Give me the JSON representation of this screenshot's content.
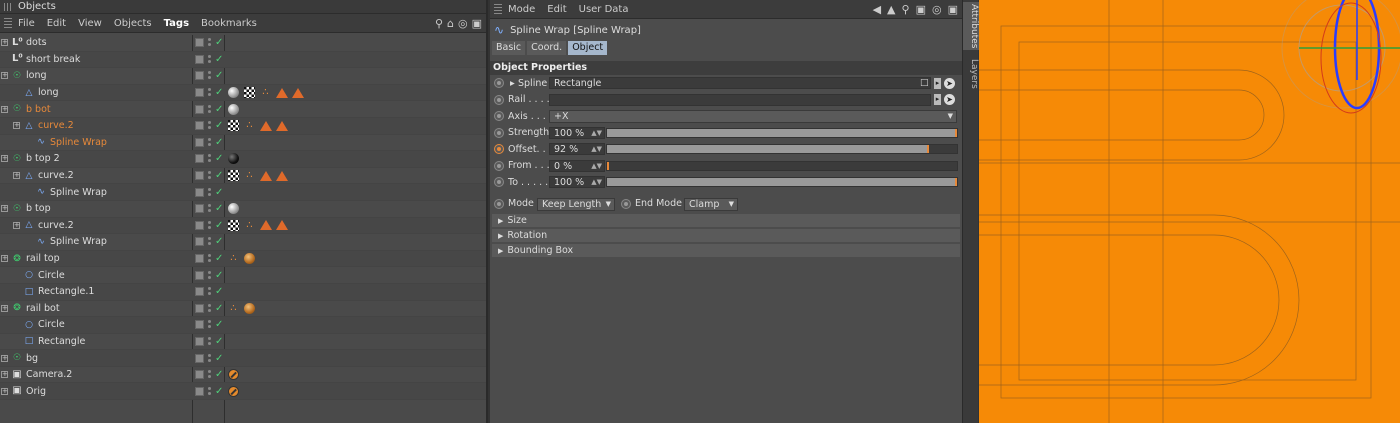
{
  "objects_panel": {
    "title": "Objects",
    "menu": [
      "File",
      "Edit",
      "View",
      "Objects",
      "Tags",
      "Bookmarks"
    ],
    "rows": [
      {
        "name": "dots",
        "icon": "null",
        "level": 0,
        "expand": true,
        "tags": []
      },
      {
        "name": "short break",
        "icon": "null",
        "level": 0,
        "expand": false,
        "tags": []
      },
      {
        "name": "long",
        "icon": "cloner",
        "level": 0,
        "expand": true,
        "tags": []
      },
      {
        "name": "long",
        "icon": "spline-tri",
        "level": 1,
        "expand": false,
        "tags": [
          "sphere",
          "check",
          "orangedots",
          "tri",
          "tri"
        ]
      },
      {
        "name": "b bot",
        "icon": "cloner",
        "level": 0,
        "expand": true,
        "orange": true,
        "tags": [
          "sphere"
        ]
      },
      {
        "name": "curve.2",
        "icon": "spline-tri",
        "level": 1,
        "expand": true,
        "orange": true,
        "tags": [
          "check",
          "orangedots",
          "tri",
          "tri"
        ]
      },
      {
        "name": "Spline Wrap",
        "icon": "splinewrap",
        "level": 2,
        "expand": false,
        "orange": true,
        "tags": []
      },
      {
        "name": "b top 2",
        "icon": "cloner",
        "level": 0,
        "expand": true,
        "tags": [
          "darksphere"
        ]
      },
      {
        "name": "curve.2",
        "icon": "spline-tri",
        "level": 1,
        "expand": true,
        "tags": [
          "check",
          "orangedots",
          "tri",
          "tri"
        ]
      },
      {
        "name": "Spline Wrap",
        "icon": "splinewrap",
        "level": 2,
        "expand": false,
        "tags": []
      },
      {
        "name": "b top",
        "icon": "cloner",
        "level": 0,
        "expand": true,
        "tags": [
          "sphere"
        ]
      },
      {
        "name": "curve.2",
        "icon": "spline-tri",
        "level": 1,
        "expand": true,
        "tags": [
          "check",
          "orangedots",
          "tri",
          "tri"
        ]
      },
      {
        "name": "Spline Wrap",
        "icon": "splinewrap",
        "level": 2,
        "expand": false,
        "tags": []
      },
      {
        "name": "rail top",
        "icon": "sweep",
        "level": 0,
        "expand": true,
        "tags": [
          "orangedots",
          "orbs"
        ]
      },
      {
        "name": "Circle",
        "icon": "circle",
        "level": 1,
        "expand": false,
        "tags": []
      },
      {
        "name": "Rectangle.1",
        "icon": "rect",
        "level": 1,
        "expand": false,
        "tags": []
      },
      {
        "name": "rail bot",
        "icon": "sweep",
        "level": 0,
        "expand": true,
        "tags": [
          "orangedots",
          "orbs"
        ]
      },
      {
        "name": "Circle",
        "icon": "circle",
        "level": 1,
        "expand": false,
        "tags": []
      },
      {
        "name": "Rectangle",
        "icon": "rect",
        "level": 1,
        "expand": false,
        "tags": []
      },
      {
        "name": "bg",
        "icon": "cloner",
        "level": 0,
        "expand": true,
        "tags": []
      },
      {
        "name": "Camera.2",
        "icon": "camera",
        "level": 0,
        "expand": true,
        "tags": [
          "noentry"
        ]
      },
      {
        "name": "Orig",
        "icon": "camera",
        "level": 0,
        "expand": true,
        "tags": [
          "noentry"
        ]
      }
    ]
  },
  "attributes_panel": {
    "menu": [
      "Mode",
      "Edit",
      "User Data"
    ],
    "title": "Spline Wrap [Spline Wrap]",
    "tabs": [
      "Basic",
      "Coord.",
      "Object"
    ],
    "active_tab": "Object",
    "section": "Object Properties",
    "spline_label": "Spline",
    "spline_value": "Rectangle",
    "rail_label": "Rail . . . .",
    "rail_value": "",
    "axis_label": "Axis . . . .",
    "axis_value": "+X",
    "sliders": [
      {
        "label": "Strength",
        "value": "100 %",
        "fraction": 1.0
      },
      {
        "label": "Offset. .",
        "value": "92 %",
        "fraction": 0.92,
        "animated": true
      },
      {
        "label": "From . . .",
        "value": "0 %",
        "fraction": 0.0
      },
      {
        "label": "To . . . . .",
        "value": "100 %",
        "fraction": 1.0
      }
    ],
    "mode_label": "Mode",
    "mode_value": "Keep Length",
    "endmode_label": "End Mode",
    "endmode_value": "Clamp",
    "groups": [
      "Size",
      "Rotation",
      "Bounding Box"
    ]
  },
  "side_tabs": [
    "Attributes",
    "Layers"
  ],
  "viewport": {
    "bg_color": "#f68a06"
  }
}
